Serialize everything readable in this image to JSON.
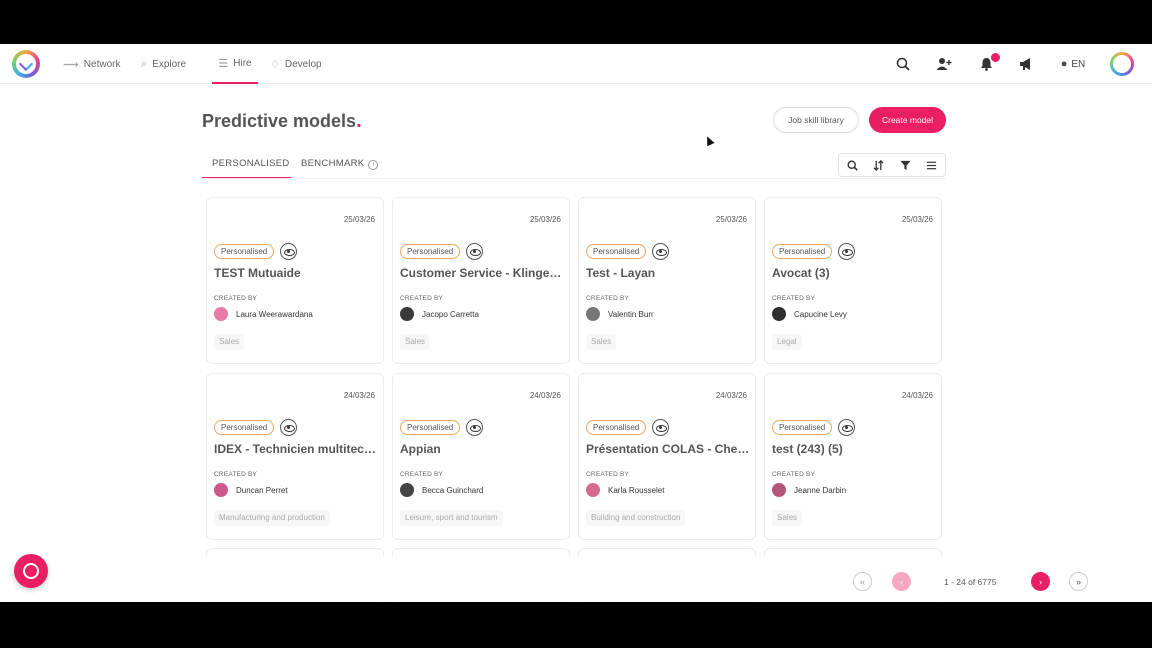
{
  "nav": {
    "items": [
      {
        "label": "Network",
        "icon": "network-icon",
        "glyph": "⟿"
      },
      {
        "label": "Explore",
        "icon": "explore-icon",
        "glyph": "⌕"
      },
      {
        "label": "Hire",
        "icon": "hire-icon",
        "glyph": "☰"
      },
      {
        "label": "Develop",
        "icon": "develop-icon",
        "glyph": "♢"
      }
    ],
    "active": "Hire",
    "language": "EN"
  },
  "header": {
    "title": "Predictive models",
    "title_dot": ".",
    "job_skill_library": "Job skill library",
    "create_model": "Create model"
  },
  "tabs": [
    {
      "label": "PERSONALISED",
      "active": true
    },
    {
      "label": "BENCHMARK",
      "active": false
    }
  ],
  "cards": [
    {
      "date": "25/03/26",
      "badge": "Personalised",
      "title": "TEST Mutuaide",
      "created_by_label": "CREATED BY",
      "creator": "Laura Weerawardana",
      "tag": "Sales",
      "avatar_color": "#e87aa8"
    },
    {
      "date": "25/03/26",
      "badge": "Personalised",
      "title": "Customer Service - Klinger I...",
      "created_by_label": "CREATED BY",
      "creator": "Jacopo Carretta",
      "tag": "Sales",
      "avatar_color": "#3a3a3a"
    },
    {
      "date": "25/03/26",
      "badge": "Personalised",
      "title": "Test - Layan",
      "created_by_label": "CREATED BY",
      "creator": "Valentin Burr",
      "tag": "Sales",
      "avatar_color": "#777777"
    },
    {
      "date": "25/03/26",
      "badge": "Personalised",
      "title": "Avocat (3)",
      "created_by_label": "CREATED BY",
      "creator": "Capucine Levy",
      "tag": "Legal",
      "avatar_color": "#2f2f2f"
    },
    {
      "date": "24/03/26",
      "badge": "Personalised",
      "title": "IDEX - Technicien multitech...",
      "created_by_label": "CREATED BY",
      "creator": "Duncan Perret",
      "tag": "Manufacturing and production",
      "avatar_color": "#d0578a"
    },
    {
      "date": "24/03/26",
      "badge": "Personalised",
      "title": "Appian",
      "created_by_label": "CREATED BY",
      "creator": "Becca Guinchard",
      "tag": "Leisure, sport and tourism",
      "avatar_color": "#444444"
    },
    {
      "date": "24/03/26",
      "badge": "Personalised",
      "title": "Présentation COLAS - Chef ...",
      "created_by_label": "CREATED BY",
      "creator": "Karla Rousselet",
      "tag": "Building and construction",
      "avatar_color": "#d46a8f"
    },
    {
      "date": "24/03/26",
      "badge": "Personalised",
      "title": "test (243) (5)",
      "created_by_label": "CREATED BY",
      "creator": "Jeanne Darbin",
      "tag": "Sales",
      "avatar_color": "#b4557a"
    }
  ],
  "pagination": {
    "range_text": "1 - 24 of 6775",
    "first": "«",
    "prev": "‹",
    "next": "›",
    "last": "»"
  },
  "colors": {
    "accent": "#e91e63",
    "badge_border": "#f0a55a"
  }
}
